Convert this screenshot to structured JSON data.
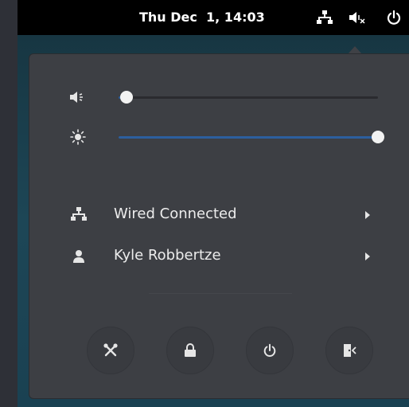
{
  "topbar": {
    "clock": "Thu Dec  1, 14:03",
    "icons": [
      "network-wired-icon",
      "volume-muted-icon",
      "power-icon"
    ]
  },
  "sliders": {
    "volume": {
      "icon": "volume-icon",
      "level": 0.03
    },
    "brightness": {
      "icon": "brightness-icon",
      "level": 1.0
    }
  },
  "items": {
    "network": {
      "icon": "network-wired-icon",
      "label": "Wired Connected"
    },
    "user": {
      "icon": "user-icon",
      "label": "Kyle Robbertze"
    }
  },
  "actions": [
    "settings-button",
    "lock-button",
    "power-off-button",
    "suspend-button"
  ],
  "colors": {
    "accent": "#2c5f9e",
    "menu_bg": "#3d3f44",
    "topbar_bg": "#000000"
  }
}
